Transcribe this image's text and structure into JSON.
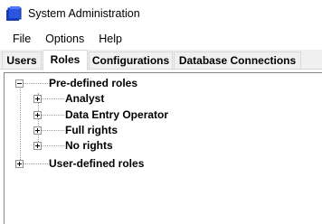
{
  "window": {
    "title": "System Administration"
  },
  "menu": {
    "items": [
      "File",
      "Options",
      "Help"
    ]
  },
  "tabs": [
    {
      "label": "Users",
      "active": false
    },
    {
      "label": "Roles",
      "active": true
    },
    {
      "label": "Configurations",
      "active": false
    },
    {
      "label": "Database Connections",
      "active": false
    }
  ],
  "tree": {
    "predefined": {
      "label": "Pre-defined roles",
      "expanded": true,
      "children": [
        "Analyst",
        "Data Entry Operator",
        "Full rights",
        "No rights"
      ]
    },
    "userdefined": {
      "label": "User-defined roles",
      "expanded": false
    }
  },
  "colors": {
    "icon_blue": "#1c3fbf",
    "tab_border": "#d9d9d9",
    "tree_lines": "#a0a0a0"
  }
}
